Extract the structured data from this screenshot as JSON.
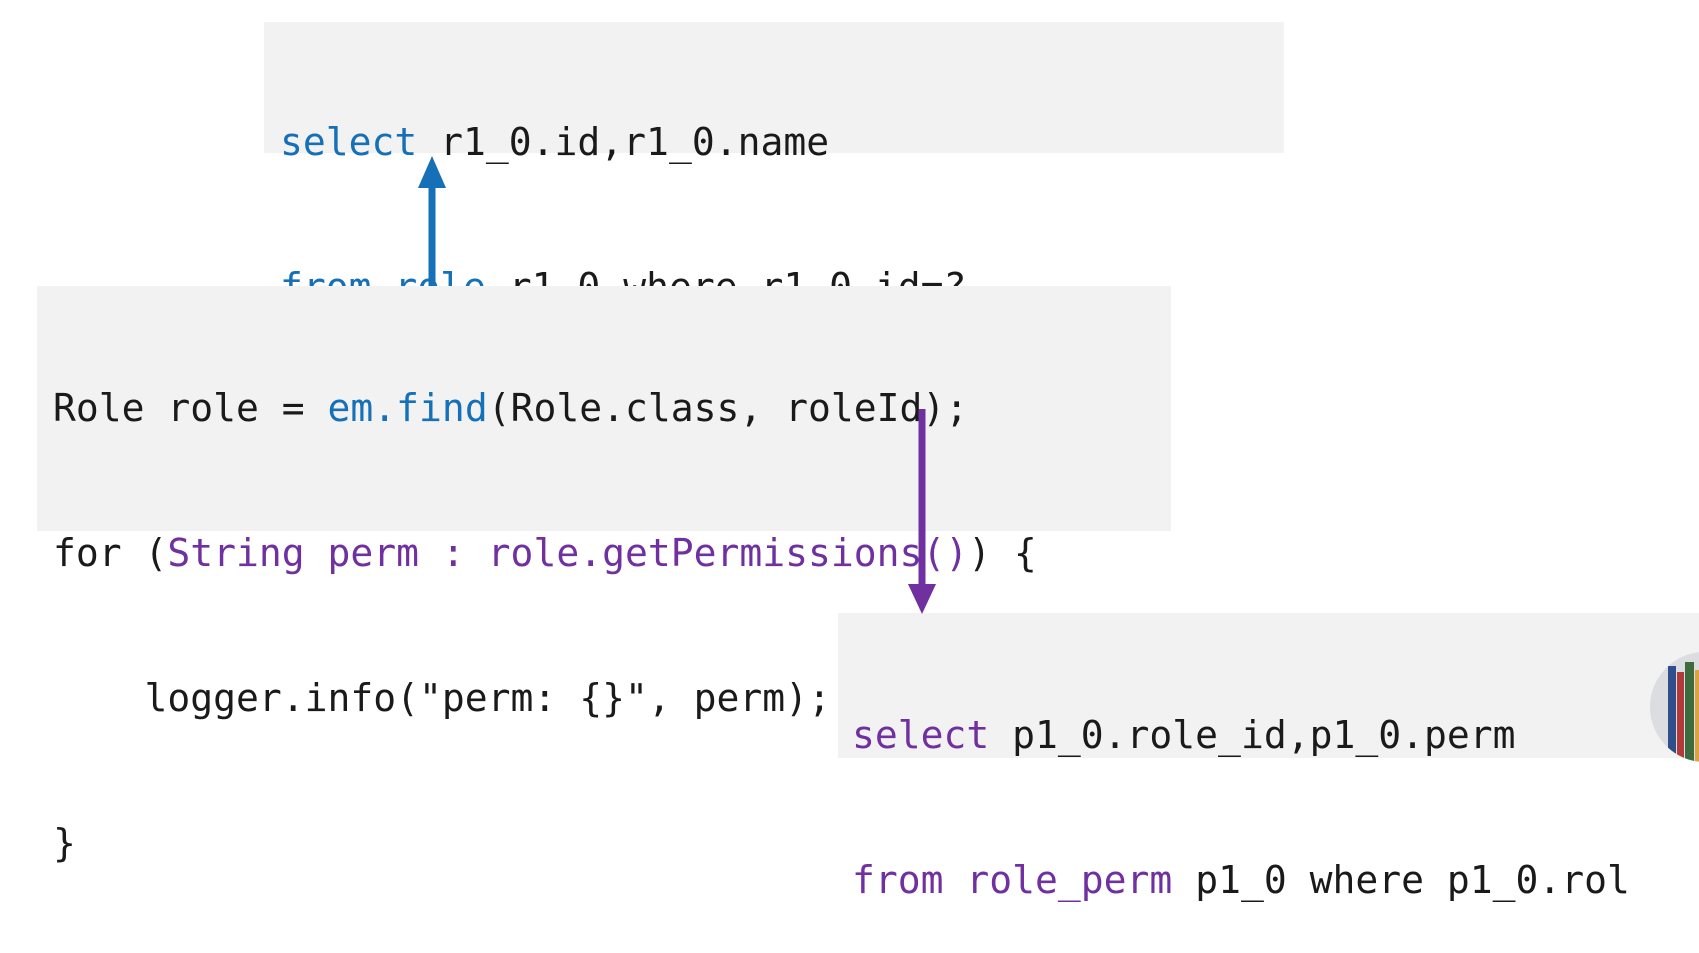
{
  "role_query": {
    "line1": [
      {
        "text": "select",
        "color": "blue"
      },
      {
        "text": " r1_0.id,r1_0.name",
        "color": "black"
      }
    ],
    "line2": [
      {
        "text": "from",
        "color": "blue"
      },
      {
        "text": " ",
        "color": "black"
      },
      {
        "text": "role",
        "color": "blue"
      },
      {
        "text": " r1_0 where r1_0.id=?",
        "color": "black"
      }
    ]
  },
  "java_code": {
    "line1": [
      {
        "text": "Role role = ",
        "color": "black"
      },
      {
        "text": "em.find",
        "color": "blue"
      },
      {
        "text": "(Role.class, roleId);",
        "color": "black"
      }
    ],
    "line2": [
      {
        "text": "for (",
        "color": "black"
      },
      {
        "text": "String perm : role.getPermissions()",
        "color": "purple"
      },
      {
        "text": ") {",
        "color": "black"
      }
    ],
    "line3": [
      {
        "text": "    logger.info(\"perm: {}\", perm);",
        "color": "black"
      }
    ],
    "line4": [
      {
        "text": "}",
        "color": "black"
      }
    ]
  },
  "perm_query": {
    "line1": [
      {
        "text": "select",
        "color": "purple"
      },
      {
        "text": " p1_0.role_id,p1_0.perm",
        "color": "black"
      }
    ],
    "line2": [
      {
        "text": "from",
        "color": "purple"
      },
      {
        "text": " ",
        "color": "black"
      },
      {
        "text": "role_perm",
        "color": "purple"
      },
      {
        "text": " p1_0 where p1_0.rol",
        "color": "black"
      }
    ]
  },
  "colors": {
    "blue": "#1570b8",
    "purple": "#7030a0",
    "black": "#1a1a1a",
    "code_background": "#f2f2f2"
  },
  "arrows": [
    {
      "name": "find-to-role-query-arrow",
      "color": "blue",
      "direction": "up"
    },
    {
      "name": "getpermissions-to-perm-query-arrow",
      "color": "purple",
      "direction": "down"
    }
  ],
  "icons": {
    "presenter": "presenter-avatar-icon"
  }
}
